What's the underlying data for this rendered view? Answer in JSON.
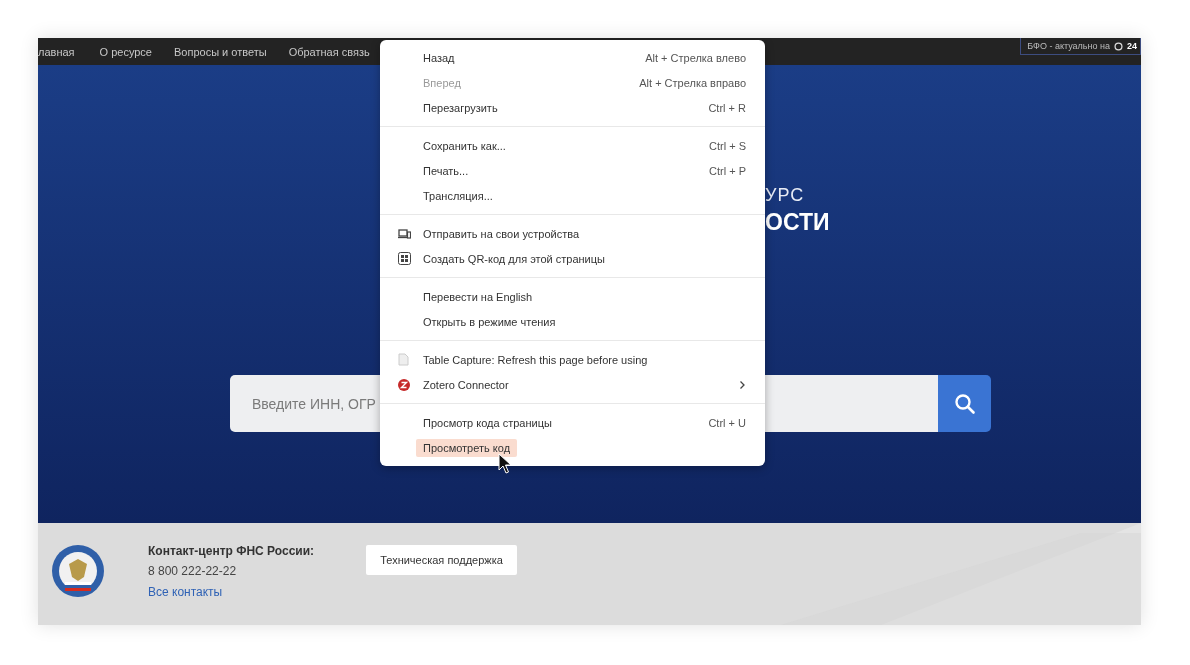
{
  "nav": {
    "items": [
      {
        "label": "лавная"
      },
      {
        "label": "О ресурсе"
      },
      {
        "label": "Вопросы и ответы"
      },
      {
        "label": "Обратная связь"
      }
    ],
    "status": {
      "label": "БФО - актуально на",
      "value": "24"
    }
  },
  "hero": {
    "title_lines": [
      "УРС",
      "ОСТИ"
    ],
    "search": {
      "placeholder": "Введите ИНН, ОГР"
    }
  },
  "context_menu": {
    "groups": [
      {
        "items": [
          {
            "kind": "plain",
            "label": "Назад",
            "shortcut": "Alt + Стрелка влево",
            "disabled": false,
            "selected": false,
            "has_submenu": false
          },
          {
            "kind": "plain",
            "label": "Вперед",
            "shortcut": "Alt + Стрелка вправо",
            "disabled": true,
            "selected": false,
            "has_submenu": false
          },
          {
            "kind": "plain",
            "label": "Перезагрузить",
            "shortcut": "Ctrl + R",
            "disabled": false,
            "selected": false,
            "has_submenu": false
          }
        ]
      },
      {
        "items": [
          {
            "kind": "plain",
            "label": "Сохранить как...",
            "shortcut": "Ctrl + S",
            "disabled": false,
            "selected": false,
            "has_submenu": false
          },
          {
            "kind": "plain",
            "label": "Печать...",
            "shortcut": "Ctrl + P",
            "disabled": false,
            "selected": false,
            "has_submenu": false
          },
          {
            "kind": "plain",
            "label": "Трансляция...",
            "disabled": false,
            "selected": false,
            "has_submenu": false
          }
        ]
      },
      {
        "items": [
          {
            "kind": "devices",
            "label": "Отправить на свои устройства",
            "disabled": false,
            "selected": false,
            "has_submenu": false
          },
          {
            "kind": "qr",
            "label": "Создать QR-код для этой страницы",
            "disabled": false,
            "selected": false,
            "has_submenu": false
          }
        ]
      },
      {
        "items": [
          {
            "kind": "plain",
            "label": "Перевести на English",
            "disabled": false,
            "selected": false,
            "has_submenu": false
          },
          {
            "kind": "plain",
            "label": "Открыть в режиме чтения",
            "disabled": false,
            "selected": false,
            "has_submenu": false
          }
        ]
      },
      {
        "items": [
          {
            "kind": "page",
            "label": "Table Capture: Refresh this page before using",
            "disabled": false,
            "selected": false,
            "has_submenu": false
          },
          {
            "kind": "zotero",
            "label": "Zotero Connector",
            "disabled": false,
            "selected": false,
            "has_submenu": true
          }
        ]
      },
      {
        "items": [
          {
            "kind": "plain",
            "label": "Просмотр кода страницы",
            "shortcut": "Ctrl + U",
            "disabled": false,
            "selected": false,
            "has_submenu": false
          },
          {
            "kind": "plain",
            "label": "Просмотреть код",
            "disabled": false,
            "selected": true,
            "has_submenu": false
          }
        ]
      }
    ]
  },
  "footer": {
    "contact_title": "Контакт-центр ФНС России:",
    "phone": "8 800 222-22-22",
    "contacts_link": "Все контакты",
    "support_button": "Техническая поддержка"
  }
}
